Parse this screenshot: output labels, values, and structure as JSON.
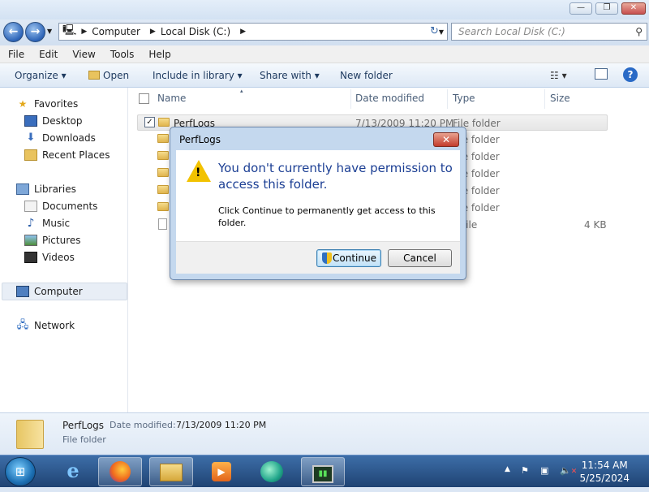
{
  "address": {
    "crumbs": [
      "Computer",
      "Local Disk (C:)"
    ],
    "search_placeholder": "Search Local Disk (C:)"
  },
  "menu": [
    "File",
    "Edit",
    "View",
    "Tools",
    "Help"
  ],
  "toolbar": {
    "organize": "Organize",
    "open": "Open",
    "include": "Include in library",
    "share": "Share with",
    "new_folder": "New folder"
  },
  "nav": {
    "favorites": "Favorites",
    "desktop": "Desktop",
    "downloads": "Downloads",
    "recent": "Recent Places",
    "libraries": "Libraries",
    "documents": "Documents",
    "music": "Music",
    "pictures": "Pictures",
    "videos": "Videos",
    "computer": "Computer",
    "network": "Network"
  },
  "columns": {
    "name": "Name",
    "date": "Date modified",
    "type": "Type",
    "size": "Size"
  },
  "rows": [
    {
      "name": "PerfLogs",
      "date": "7/13/2009 11:20 PM",
      "type": "File folder",
      "size": ""
    },
    {
      "name": "",
      "date": "",
      "type": "File folder",
      "size": ""
    },
    {
      "name": "",
      "date": "",
      "type": "File folder",
      "size": ""
    },
    {
      "name": "",
      "date": "",
      "type": "File folder",
      "size": ""
    },
    {
      "name": "",
      "date": "",
      "type": "File folder",
      "size": ""
    },
    {
      "name": "",
      "date": "",
      "type": "File folder",
      "size": ""
    },
    {
      "name": "",
      "date": "",
      "type": "T File",
      "size": "4 KB"
    }
  ],
  "status": {
    "name": "PerfLogs",
    "date_label": "Date modified:",
    "date": "7/13/2009 11:20 PM",
    "type": "File folder"
  },
  "dialog": {
    "title": "PerfLogs",
    "main": "You don't currently have permission to access this folder.",
    "sub": "Click Continue to permanently get access to this folder.",
    "continue": "Continue",
    "cancel": "Cancel"
  },
  "clock": {
    "time": "11:54 AM",
    "date": "5/25/2024"
  }
}
